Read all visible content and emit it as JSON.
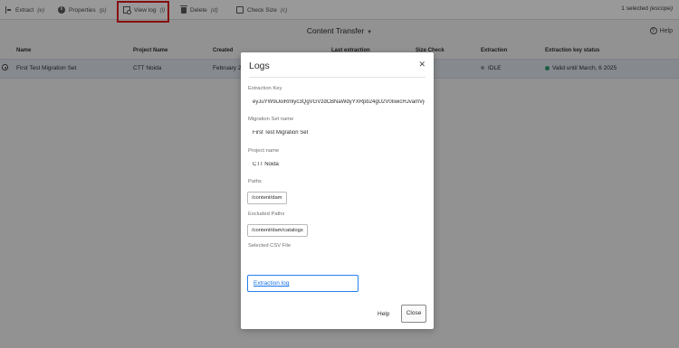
{
  "toolbar": {
    "items": [
      {
        "label": "Extract",
        "shortcut": "(e)",
        "icon": "extract-icon"
      },
      {
        "label": "Properties",
        "shortcut": "(p)",
        "icon": "info-icon"
      },
      {
        "label": "View log",
        "shortcut": "(l)",
        "icon": "view-log-icon"
      },
      {
        "label": "Delete",
        "shortcut": "(d)",
        "icon": "trash-icon"
      },
      {
        "label": "Check Size",
        "shortcut": "(c)",
        "icon": "check-size-icon"
      }
    ],
    "selection_count": "1 selected",
    "selection_shortcut": "(escope)",
    "highlight_color": "#e0161b"
  },
  "header": {
    "title": "Content Transfer",
    "help_label": "Help"
  },
  "table": {
    "columns": [
      "Name",
      "Project Name",
      "Created",
      "Last extraction",
      "Size Check",
      "Extraction",
      "Extraction key status"
    ],
    "rows": [
      {
        "name": "First Test Migration Set",
        "project": "CTT Noida",
        "created": "February 20",
        "extraction": "IDLE",
        "key_status": "Valid until March, 6 2025",
        "key_status_color": "#2e9c6e"
      }
    ]
  },
  "dialog": {
    "title": "Logs",
    "extraction_key_label": "Extraction Key",
    "extraction_key_value": "eyJuYW9iJoiRmlyc3QgVGVzdCBNaWdyYXRpb24gU2V0IiwicHJvamVjdE5hbWUiOiJDVFQgTm9pZGEifQ",
    "migration_set_label": "Migration Set name",
    "migration_set_value": "First Test Migration Set",
    "project_label": "Project name",
    "project_value": "CTT Noida",
    "paths_label": "Paths",
    "paths_value": "/content/dam",
    "excluded_paths_label": "Excluded Paths",
    "excluded_paths_value": "/content/dam/catalogs",
    "csv_label": "Selected CSV File",
    "extraction_log_link": "Extraction log",
    "help_button": "Help",
    "close_button": "Close",
    "link_color": "#1473e6"
  }
}
